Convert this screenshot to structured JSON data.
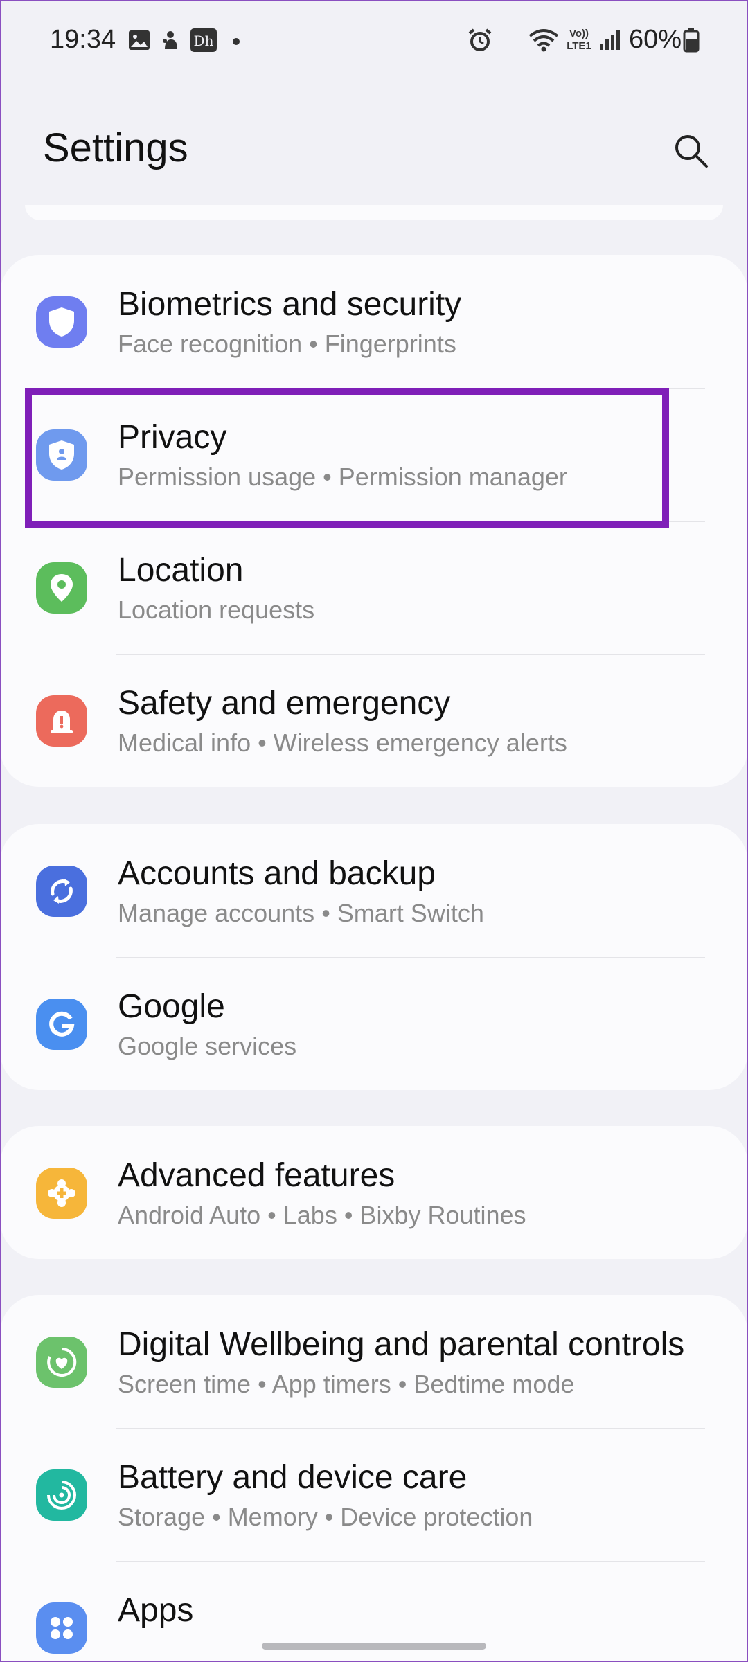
{
  "status_bar": {
    "time": "19:34",
    "battery_percent": "60%",
    "lte_label": "LTE1",
    "volte_label": "Vo))",
    "icons": [
      "gallery-icon",
      "notification-app-icon",
      "disney-hotstar-icon",
      "dot-icon",
      "alarm-icon",
      "wifi-icon",
      "signal-icon",
      "battery-icon"
    ]
  },
  "header": {
    "title": "Settings",
    "search_icon": "search-icon"
  },
  "groups": [
    {
      "items": [
        {
          "title": "Biometrics and security",
          "subtitle_parts": [
            "Face recognition",
            "Fingerprints"
          ],
          "icon": "shield-icon",
          "color": "#6f7ef0"
        },
        {
          "title": "Privacy",
          "subtitle_parts": [
            "Permission usage",
            "Permission manager"
          ],
          "icon": "privacy-shield-icon",
          "color": "#6f9aee"
        },
        {
          "title": "Location",
          "subtitle_parts": [
            "Location requests"
          ],
          "icon": "location-pin-icon",
          "color": "#5cbd5c"
        },
        {
          "title": "Safety and emergency",
          "subtitle_parts": [
            "Medical info",
            "Wireless emergency alerts"
          ],
          "icon": "emergency-siren-icon",
          "color": "#ec6a5c"
        }
      ]
    },
    {
      "items": [
        {
          "title": "Accounts and backup",
          "subtitle_parts": [
            "Manage accounts",
            "Smart Switch"
          ],
          "icon": "sync-icon",
          "color": "#4a6fde"
        },
        {
          "title": "Google",
          "subtitle_parts": [
            "Google services"
          ],
          "icon": "google-g-icon",
          "color": "#4a8ff0"
        }
      ]
    },
    {
      "items": [
        {
          "title": "Advanced features",
          "subtitle_parts": [
            "Android Auto",
            "Labs",
            "Bixby Routines"
          ],
          "icon": "puzzle-gear-icon",
          "color": "#f6b63a"
        }
      ]
    },
    {
      "items": [
        {
          "title": "Digital Wellbeing and parental controls",
          "subtitle_parts": [
            "Screen time",
            "App timers",
            "Bedtime mode"
          ],
          "icon": "wellbeing-heart-icon",
          "color": "#6cc26c"
        },
        {
          "title": "Battery and device care",
          "subtitle_parts": [
            "Storage",
            "Memory",
            "Device protection"
          ],
          "icon": "device-care-icon",
          "color": "#22b8a0"
        },
        {
          "title": "Apps",
          "subtitle_parts": [],
          "icon": "apps-grid-icon",
          "color": "#5a8ef0"
        }
      ]
    }
  ],
  "subtitles": {
    "g0_0": "Face recognition  •  Fingerprints",
    "g0_1": "Permission usage  •  Permission manager",
    "g0_2": "Location requests",
    "g0_3": "Medical info  •  Wireless emergency alerts",
    "g1_0": "Manage accounts  •  Smart Switch",
    "g1_1": "Google services",
    "g2_0": "Android Auto  •  Labs  •  Bixby Routines",
    "g3_0": "Screen time  •  App timers  •  Bedtime mode",
    "g3_1": "Storage  •  Memory  •  Device protection"
  },
  "highlight_color": "#7f1fb8"
}
